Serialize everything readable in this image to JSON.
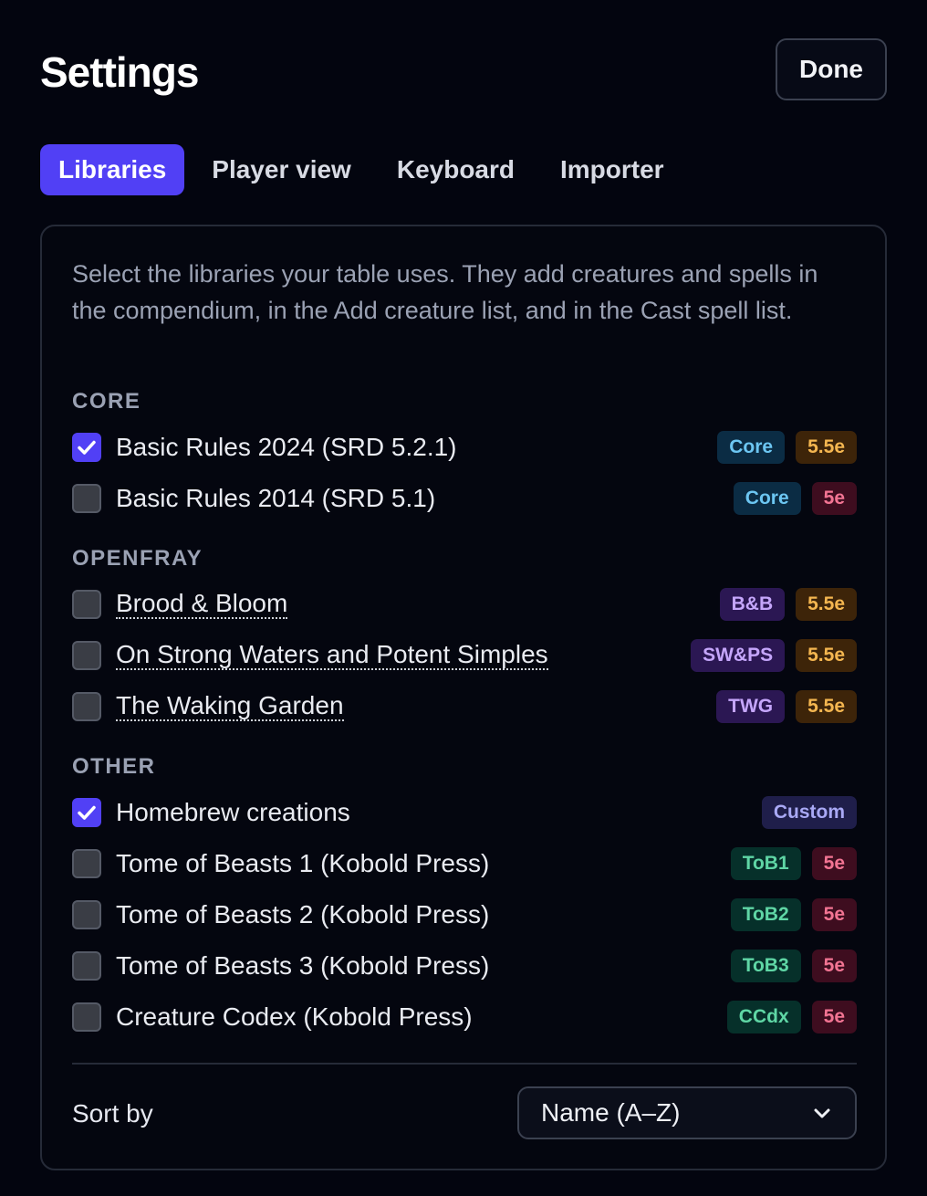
{
  "header": {
    "title": "Settings",
    "done_label": "Done"
  },
  "tabs": [
    {
      "label": "Libraries",
      "active": true
    },
    {
      "label": "Player view",
      "active": false
    },
    {
      "label": "Keyboard",
      "active": false
    },
    {
      "label": "Importer",
      "active": false
    }
  ],
  "panel": {
    "intro": "Select the libraries your table uses. They add creatures and spells in the compendium, in the Add creature list, and in the Cast spell list.",
    "sections": [
      {
        "label": "CORE",
        "items": [
          {
            "label": "Basic Rules 2024 (SRD 5.2.1)",
            "checked": true,
            "link": false,
            "badges": [
              {
                "text": "Core",
                "bg": "#0b2c44",
                "fg": "#6cc6f2"
              },
              {
                "text": "5.5e",
                "bg": "#3d2409",
                "fg": "#f4b650"
              }
            ]
          },
          {
            "label": "Basic Rules 2014 (SRD 5.1)",
            "checked": false,
            "link": false,
            "badges": [
              {
                "text": "Core",
                "bg": "#0b2c44",
                "fg": "#6cc6f2"
              },
              {
                "text": "5e",
                "bg": "#3e0d1f",
                "fg": "#f27493"
              }
            ]
          }
        ]
      },
      {
        "label": "OPENFRAY",
        "items": [
          {
            "label": "Brood & Bloom",
            "checked": false,
            "link": true,
            "badges": [
              {
                "text": "B&B",
                "bg": "#2b1753",
                "fg": "#c5a6fb"
              },
              {
                "text": "5.5e",
                "bg": "#3d2409",
                "fg": "#f4b650"
              }
            ]
          },
          {
            "label": "On Strong Waters and Potent Simples",
            "checked": false,
            "link": true,
            "badges": [
              {
                "text": "SW&PS",
                "bg": "#2b1753",
                "fg": "#c5a6fb"
              },
              {
                "text": "5.5e",
                "bg": "#3d2409",
                "fg": "#f4b650"
              }
            ]
          },
          {
            "label": "The Waking Garden",
            "checked": false,
            "link": true,
            "badges": [
              {
                "text": "TWG",
                "bg": "#2b1753",
                "fg": "#c5a6fb"
              },
              {
                "text": "5.5e",
                "bg": "#3d2409",
                "fg": "#f4b650"
              }
            ]
          }
        ]
      },
      {
        "label": "OTHER",
        "items": [
          {
            "label": "Homebrew creations",
            "checked": true,
            "link": false,
            "badges": [
              {
                "text": "Custom",
                "bg": "#1f1e4a",
                "fg": "#a9a9f5"
              }
            ]
          },
          {
            "label": "Tome of Beasts 1 (Kobold Press)",
            "checked": false,
            "link": false,
            "badges": [
              {
                "text": "ToB1",
                "bg": "#06302a",
                "fg": "#5fd6a5"
              },
              {
                "text": "5e",
                "bg": "#3e0d1f",
                "fg": "#f27493"
              }
            ]
          },
          {
            "label": "Tome of Beasts 2 (Kobold Press)",
            "checked": false,
            "link": false,
            "badges": [
              {
                "text": "ToB2",
                "bg": "#06302a",
                "fg": "#5fd6a5"
              },
              {
                "text": "5e",
                "bg": "#3e0d1f",
                "fg": "#f27493"
              }
            ]
          },
          {
            "label": "Tome of Beasts 3 (Kobold Press)",
            "checked": false,
            "link": false,
            "badges": [
              {
                "text": "ToB3",
                "bg": "#06302a",
                "fg": "#5fd6a5"
              },
              {
                "text": "5e",
                "bg": "#3e0d1f",
                "fg": "#f27493"
              }
            ]
          },
          {
            "label": "Creature Codex (Kobold Press)",
            "checked": false,
            "link": false,
            "badges": [
              {
                "text": "CCdx",
                "bg": "#06302a",
                "fg": "#5fd6a5"
              },
              {
                "text": "5e",
                "bg": "#3e0d1f",
                "fg": "#f27493"
              }
            ]
          }
        ]
      }
    ],
    "sort": {
      "label": "Sort by",
      "value": "Name (A–Z)",
      "icon": "chevron-down-icon"
    }
  },
  "colors": {
    "accent": "#5140f5",
    "background": "#03050f"
  }
}
